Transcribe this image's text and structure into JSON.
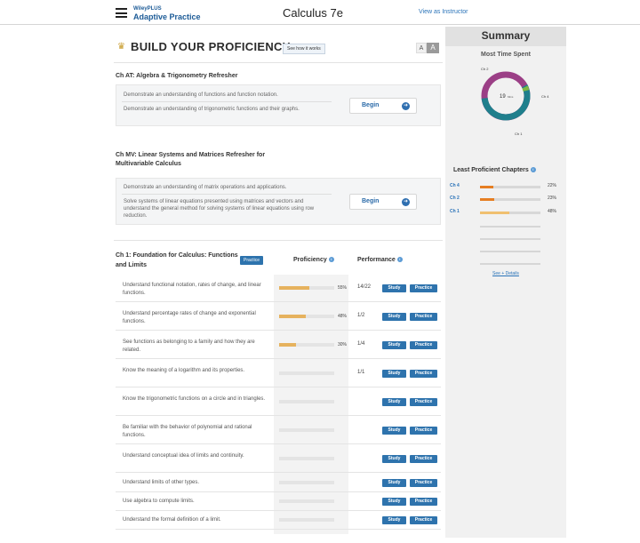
{
  "header": {
    "brand_top": "WileyPLUS",
    "brand_bottom": "Adaptive Practice",
    "course_title": "Calculus 7e",
    "instructor_link": "View as Instructor"
  },
  "build": {
    "title": "BUILD YOUR PROFICIENCY",
    "see_how": "See how it works",
    "font_small": "A",
    "font_large": "A"
  },
  "chapters": [
    {
      "title": "Ch AT: Algebra & Trigonometry Refresher",
      "objectives": [
        "Demonstrate an understanding of functions and function notation.",
        "Demonstrate an understanding of trigonometric functions and their graphs."
      ],
      "button": "Begin"
    },
    {
      "title": "Ch MV: Linear Systems and Matrices Refresher for Multivariable Calculus",
      "objectives": [
        "Demonstrate an understanding of matrix operations and applications.",
        "Solve systems of linear equations presented using matrices and vectors and understand the general method for solving systems of linear equations using row reduction."
      ],
      "button": "Begin"
    }
  ],
  "ch1": {
    "title": "Ch 1: Foundation for Calculus: Functions and Limits",
    "practice_tag": "Practice",
    "col_proficiency": "Proficiency",
    "col_performance": "Performance",
    "study_label": "Study",
    "practice_label": "Practice",
    "rows": [
      {
        "text": "Understand functional notation, rates of change, and linear functions.",
        "pct": "55%",
        "fill": 0.55,
        "perf": "14/22"
      },
      {
        "text": "Understand percentage rates of change and exponential functions.",
        "pct": "48%",
        "fill": 0.48,
        "perf": "1/2"
      },
      {
        "text": "See functions as belonging to a family and how they are related.",
        "pct": "30%",
        "fill": 0.3,
        "perf": "1/4"
      },
      {
        "text": "Know the meaning of a logarithm and its properties.",
        "pct": "",
        "fill": 0,
        "perf": "1/1"
      },
      {
        "text": "Know the trigonometric functions on a circle and in triangles.",
        "pct": "",
        "fill": 0,
        "perf": ""
      },
      {
        "text": "Be familiar with the behavior of polynomial and rational functions.",
        "pct": "",
        "fill": 0,
        "perf": ""
      },
      {
        "text": "Understand conceptual idea of limits and continuity.",
        "pct": "",
        "fill": 0,
        "perf": ""
      },
      {
        "text": "Understand limits of other types.",
        "pct": "",
        "fill": 0,
        "perf": ""
      },
      {
        "text": "Use algebra to compute limits.",
        "pct": "",
        "fill": 0,
        "perf": ""
      },
      {
        "text": "Understand the formal definition of a limit.",
        "pct": "",
        "fill": 0,
        "perf": ""
      }
    ]
  },
  "summary": {
    "title": "Summary",
    "most_time": "Most Time Spent",
    "donut_center_value": "19",
    "donut_center_unit": "Mins",
    "donut_labels": [
      "Ch 2",
      "Ch 4",
      "Ch 1"
    ],
    "least_head": "Least Proficient Chapters",
    "least": [
      {
        "ch": "Ch 4",
        "pct": "22%",
        "fill": 0.22,
        "color": "#e67e22"
      },
      {
        "ch": "Ch 2",
        "pct": "23%",
        "fill": 0.23,
        "color": "#e67e22"
      },
      {
        "ch": "Ch 1",
        "pct": "48%",
        "fill": 0.48,
        "color": "#f0c070"
      }
    ],
    "see_details": "See + Details"
  },
  "colors": {
    "accent": "#2e73ad",
    "donut_purple": "#9b3f86",
    "donut_teal": "#1f7f8c"
  }
}
